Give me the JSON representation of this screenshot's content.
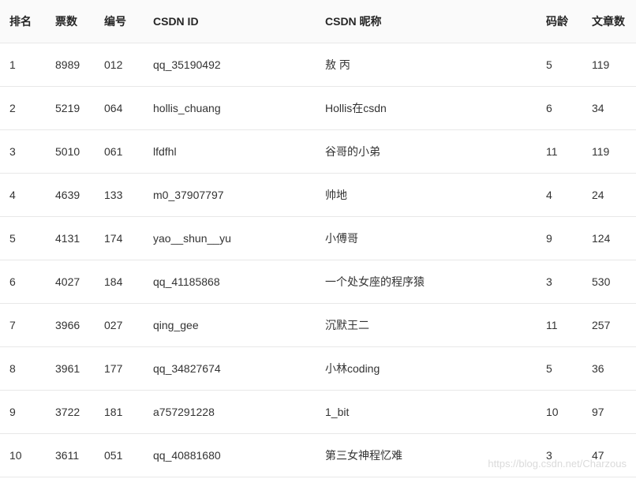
{
  "chart_data": {
    "type": "table",
    "title": "",
    "columns": [
      "排名",
      "票数",
      "编号",
      "CSDN ID",
      "CSDN 昵称",
      "码龄",
      "文章数"
    ],
    "rows": [
      [
        1,
        8989,
        "012",
        "qq_35190492",
        "敖 丙",
        5,
        119
      ],
      [
        2,
        5219,
        "064",
        "hollis_chuang",
        "Hollis在csdn",
        6,
        34
      ],
      [
        3,
        5010,
        "061",
        "lfdfhl",
        "谷哥的小弟",
        11,
        119
      ],
      [
        4,
        4639,
        "133",
        "m0_37907797",
        "帅地",
        4,
        24
      ],
      [
        5,
        4131,
        "174",
        "yao__shun__yu",
        "小傅哥",
        9,
        124
      ],
      [
        6,
        4027,
        "184",
        "qq_41185868",
        "一个处女座的程序猿",
        3,
        530
      ],
      [
        7,
        3966,
        "027",
        "qing_gee",
        "沉默王二",
        11,
        257
      ],
      [
        8,
        3961,
        "177",
        "qq_34827674",
        "小林coding",
        5,
        36
      ],
      [
        9,
        3722,
        "181",
        "a757291228",
        "1_bit",
        10,
        97
      ],
      [
        10,
        3611,
        "051",
        "qq_40881680",
        "第三女神程忆难",
        3,
        47
      ]
    ]
  },
  "table": {
    "headers": {
      "rank": "排名",
      "votes": "票数",
      "num": "编号",
      "csdn_id": "CSDN ID",
      "nickname": "CSDN 昵称",
      "age": "码龄",
      "articles": "文章数"
    },
    "rows": [
      {
        "rank": "1",
        "votes": "8989",
        "num": "012",
        "csdn_id": "qq_35190492",
        "nickname": "敖 丙",
        "age": "5",
        "articles": "119"
      },
      {
        "rank": "2",
        "votes": "5219",
        "num": "064",
        "csdn_id": "hollis_chuang",
        "nickname": "Hollis在csdn",
        "age": "6",
        "articles": "34"
      },
      {
        "rank": "3",
        "votes": "5010",
        "num": "061",
        "csdn_id": "lfdfhl",
        "nickname": "谷哥的小弟",
        "age": "11",
        "articles": "119"
      },
      {
        "rank": "4",
        "votes": "4639",
        "num": "133",
        "csdn_id": "m0_37907797",
        "nickname": "帅地",
        "age": "4",
        "articles": "24"
      },
      {
        "rank": "5",
        "votes": "4131",
        "num": "174",
        "csdn_id": "yao__shun__yu",
        "nickname": "小傅哥",
        "age": "9",
        "articles": "124"
      },
      {
        "rank": "6",
        "votes": "4027",
        "num": "184",
        "csdn_id": "qq_41185868",
        "nickname": "一个处女座的程序猿",
        "age": "3",
        "articles": "530"
      },
      {
        "rank": "7",
        "votes": "3966",
        "num": "027",
        "csdn_id": "qing_gee",
        "nickname": "沉默王二",
        "age": "11",
        "articles": "257"
      },
      {
        "rank": "8",
        "votes": "3961",
        "num": "177",
        "csdn_id": "qq_34827674",
        "nickname": "小林coding",
        "age": "5",
        "articles": "36"
      },
      {
        "rank": "9",
        "votes": "3722",
        "num": "181",
        "csdn_id": "a757291228",
        "nickname": "1_bit",
        "age": "10",
        "articles": "97"
      },
      {
        "rank": "10",
        "votes": "3611",
        "num": "051",
        "csdn_id": "qq_40881680",
        "nickname": "第三女神程忆难",
        "age": "3",
        "articles": "47"
      }
    ]
  },
  "watermark": "https://blog.csdn.net/Charzous"
}
